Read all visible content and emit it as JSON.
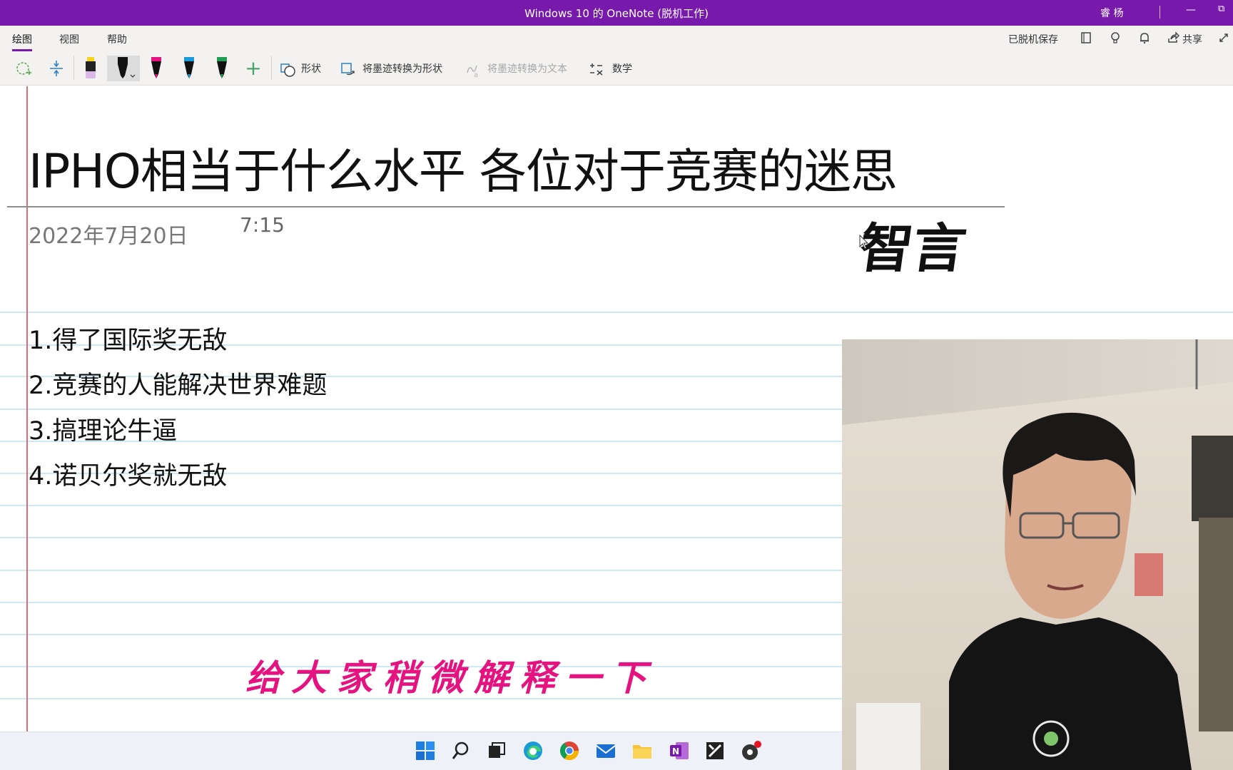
{
  "window": {
    "title": "Windows 10 的 OneNote (脱机工作)",
    "user": "睿 杨",
    "minimize_glyph": "—",
    "restore_glyph": "⧉"
  },
  "ribbon": {
    "tabs": [
      {
        "label": "绘图",
        "active": true
      },
      {
        "label": "视图",
        "active": false
      },
      {
        "label": "帮助",
        "active": false
      }
    ],
    "status": "已脱机保存",
    "share": "共享"
  },
  "toolbar": {
    "shapes_label": "形状",
    "ink_to_shape_label": "将墨迹转换为形状",
    "ink_to_text_label": "将墨迹转换为文本",
    "math_label": "数学",
    "add_pen_glyph": "+",
    "pens": [
      {
        "name": "highlighter-yellow",
        "color": "#f4d21f"
      },
      {
        "name": "pen-black",
        "color": "#111111"
      },
      {
        "name": "pen-magenta",
        "color": "#e5137f"
      },
      {
        "name": "pen-cyan",
        "color": "#1a9bd7"
      },
      {
        "name": "pen-green",
        "color": "#1f9d55"
      }
    ]
  },
  "page": {
    "title": "IPHO相当于什么水平 各位对于竞赛的迷思",
    "date": "2022年7月20日",
    "time": "7:15",
    "signature": "智言",
    "list_items": [
      "1.得了国际奖无敌",
      "2.竞赛的人能解决世界难题",
      "3.搞理论牛逼",
      "4.诺贝尔奖就无敌"
    ],
    "ink_note": "给大家稍微解释一下"
  },
  "colors": {
    "titlebar": "#7719aa",
    "ink_note": "#e5137f",
    "margin_line": "#e06c78",
    "rule_line": "#cfe8f3"
  }
}
